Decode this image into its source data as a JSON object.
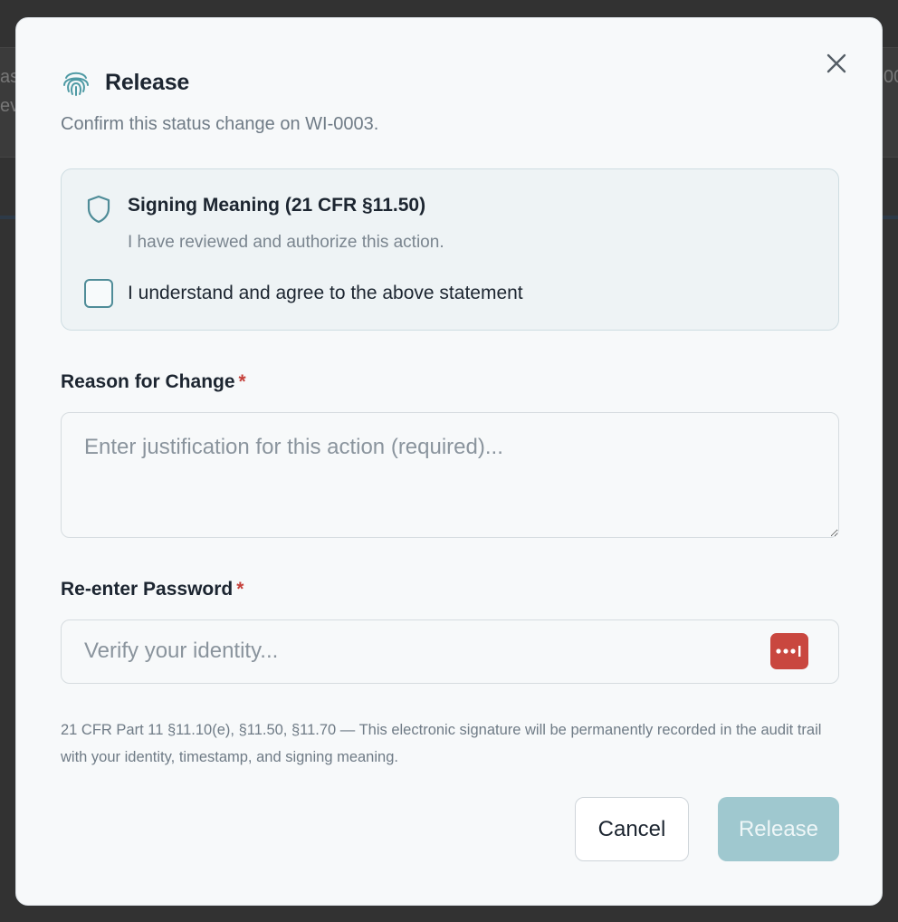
{
  "background": {
    "fragment_left_1": "as",
    "fragment_left_2": "ev",
    "fragment_right": "00"
  },
  "modal": {
    "title": "Release",
    "subtitle": "Confirm this status change on WI-0003.",
    "close_icon": "close-icon",
    "header_icon": "fingerprint-icon"
  },
  "meaning": {
    "icon": "shield-icon",
    "title": "Signing Meaning (21 CFR §11.50)",
    "text": "I have reviewed and authorize this action.",
    "agree_label": "I understand and agree to the above statement",
    "agree_checked": false
  },
  "reason": {
    "label": "Reason for Change",
    "required_mark": "*",
    "placeholder": "Enter justification for this action (required)...",
    "value": ""
  },
  "password": {
    "label": "Re-enter Password",
    "required_mark": "*",
    "placeholder": "Verify your identity...",
    "value": "",
    "icon": "password-manager-icon"
  },
  "footnote": "21 CFR Part 11 §11.10(e), §11.50, §11.70 — This electronic signature will be permanently recorded in the audit trail with your identity, timestamp, and signing meaning.",
  "actions": {
    "cancel_label": "Cancel",
    "release_label": "Release"
  },
  "colors": {
    "accent": "#4f8c98",
    "release_disabled": "#9fc8cf",
    "required": "#c5403a",
    "password_icon": "#c9473f"
  }
}
